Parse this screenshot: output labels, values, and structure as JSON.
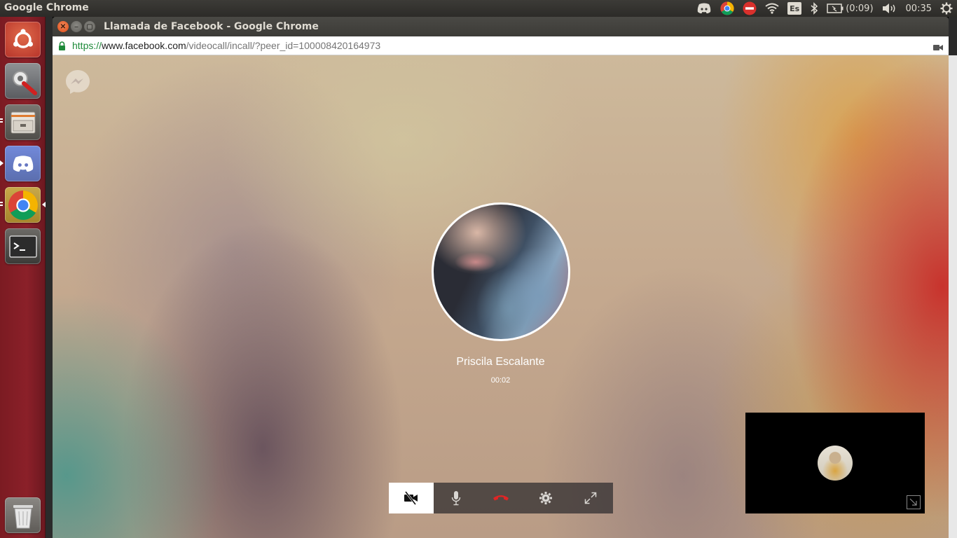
{
  "top_panel": {
    "app_title": "Google Chrome",
    "language": "Es",
    "battery": "(0:09)",
    "clock": "00:35",
    "tray_icons": [
      "discord-icon",
      "chrome-icon",
      "stop-icon",
      "wifi-icon",
      "keyboard-layout-icon",
      "bluetooth-icon",
      "battery-icon",
      "volume-icon",
      "settings-icon"
    ]
  },
  "launcher": {
    "items": [
      "ubuntu-dash",
      "system-settings",
      "files",
      "discord",
      "google-chrome",
      "terminal",
      "trash"
    ]
  },
  "window": {
    "title": "Llamada de Facebook - Google Chrome",
    "url_scheme": "https://",
    "url_host": "www.facebook.com",
    "url_path": "/videocall/incall/?peer_id=100008420164973"
  },
  "call": {
    "caller_name": "Priscila Escalante",
    "timer": "00:02",
    "controls": [
      "video-off",
      "microphone",
      "end-call",
      "settings",
      "fullscreen"
    ],
    "colors": {
      "end_call": "#e02525",
      "secure": "#1e8a3a",
      "launcher": "#8b2029"
    }
  }
}
